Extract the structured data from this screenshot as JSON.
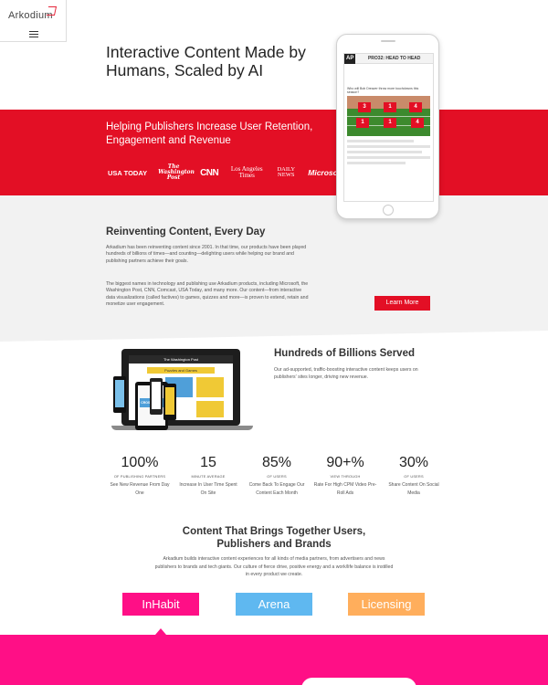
{
  "brand": {
    "name": "Arkodium",
    "accent": "#e30f25",
    "pink": "#ff0f86",
    "blue": "#5fb8f0",
    "orange": "#ffae5c"
  },
  "hero": {
    "title": "Interactive Content Made by Humans, Scaled by AI",
    "subtitle": "Helping Publishers Increase User Retention, Engagement and Revenue",
    "publishers": [
      "USA TODAY",
      "The Washington Post",
      "CNN",
      "Los Angeles Times",
      "DAILY NEWS",
      "Microsoft"
    ]
  },
  "phone": {
    "ap": "AP",
    "game_title": "PRO32: HEAD TO HEAD",
    "question": "Who will Bob Dreaver throw more touchdowns this season?",
    "tiles": [
      "3",
      "1",
      "4",
      "1",
      "1",
      "4"
    ]
  },
  "reinvent": {
    "title": "Reinventing Content, Every Day",
    "p1": "Arkadium has been reinventing content since 2001. In that time, our products have been played hundreds of billions of times—and counting—delighting users while helping our brand and publishing partners achieve their goals.",
    "p2": "The biggest names in technology and publishing use Arkadium products, including Microsoft, the Washington Post, CNN, Comcast, USA Today, and many more. Our content—from interactive data visualizations (called factives) to games, quizzes and more—is proven to extend, retain and monetize user engagement.",
    "button": "Learn More"
  },
  "devices": {
    "laptop_brand": "The Washington Post",
    "laptop_heading": "Puzzles and Games",
    "tablet_label": "CROSSWORD"
  },
  "served": {
    "title": "Hundreds of Billions Served",
    "text": "Our ad-supported, traffic-boosting interactive content keeps users on publishers' sites longer, driving new revenue."
  },
  "stats": [
    {
      "value": "100%",
      "caption": "OF PUBLISHING PARTNERS",
      "desc": "See New Revenue From Day One"
    },
    {
      "value": "15",
      "caption": "MINUTE AVERAGE",
      "desc": "Increase In User Time Spent On Site"
    },
    {
      "value": "85%",
      "caption": "OF USERS",
      "desc": "Come Back To Engage Our Content Each Month"
    },
    {
      "value": "90+%",
      "caption": "VIEW THROUGH",
      "desc": "Rate For High CPM Video Pre-Roll Ads"
    },
    {
      "value": "30%",
      "caption": "OF USERS",
      "desc": "Share Content On Social Media"
    }
  ],
  "content": {
    "title": "Content That Brings Together Users, Publishers and Brands",
    "text": "Arkadium builds interactive content experiences for all kinds of media partners, from advertisers and news publishers to brands and tech giants. Our culture of fierce drive, positive energy and a work/life balance is instilled in every product we create.",
    "tabs": [
      "InHabit",
      "Arena",
      "Licensing"
    ]
  }
}
